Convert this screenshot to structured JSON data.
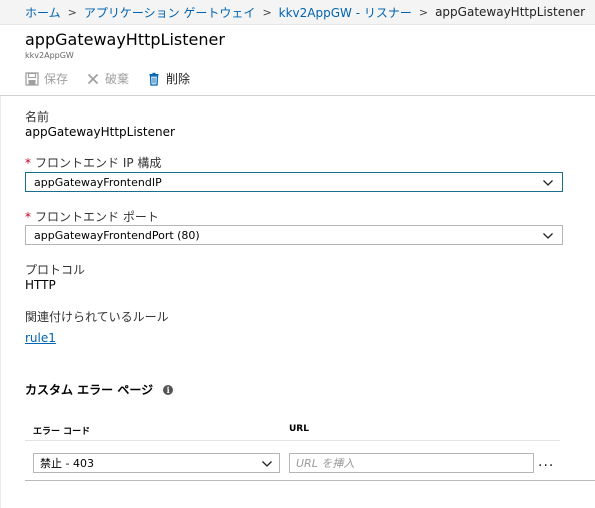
{
  "breadcrumb": {
    "items": [
      "ホーム",
      "アプリケーション ゲートウェイ",
      "kkv2AppGW - リスナー"
    ],
    "current": "appGatewayHttpListener",
    "separator": ">"
  },
  "header": {
    "title": "appGatewayHttpListener",
    "subtitle": "kkv2AppGW"
  },
  "toolbar": {
    "save_label": "保存",
    "discard_label": "破棄",
    "delete_label": "削除"
  },
  "form": {
    "name_label": "名前",
    "name_value": "appGatewayHttpListener",
    "frontend_ip_label": "フロントエンド IP 構成",
    "frontend_ip_value": "appGatewayFrontendIP",
    "frontend_port_label": "フロントエンド ポート",
    "frontend_port_value": "appGatewayFrontendPort (80)",
    "protocol_label": "プロトコル",
    "protocol_value": "HTTP",
    "rules_label": "関連付けられているルール",
    "rule_link": "rule1",
    "required_mark": "*"
  },
  "custom_error": {
    "title": "カスタム エラー ページ",
    "info_glyph": "i",
    "col_error_code": "エラー コード",
    "col_url": "URL",
    "error_code_value": "禁止 - 403",
    "url_placeholder": "URL を挿入",
    "more_label": "..."
  },
  "colors": {
    "link": "#0063b1",
    "required": "#c0001a",
    "focus_border": "#1a6e8a",
    "disabled": "#a0a0a0"
  }
}
